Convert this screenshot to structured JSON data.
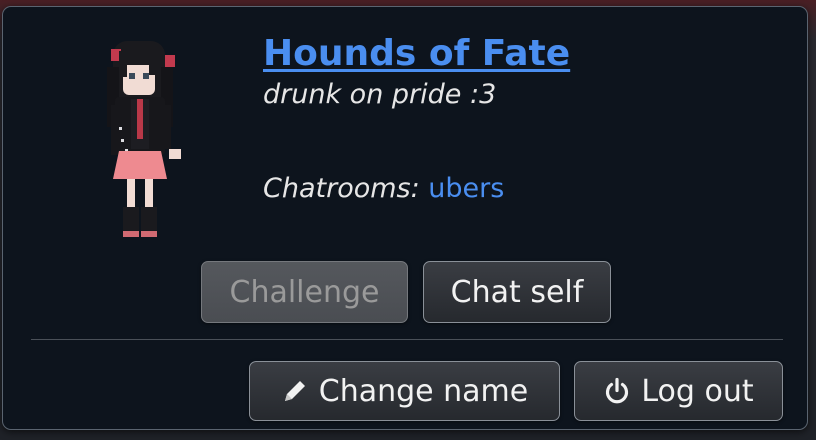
{
  "user": {
    "name": "Hounds of Fate",
    "status": "drunk on pride :3",
    "chatrooms_label": "Chatrooms:",
    "chatrooms": [
      "ubers"
    ]
  },
  "buttons": {
    "challenge": "Challenge",
    "chat_self": "Chat self",
    "change_name": "Change name",
    "log_out": "Log out"
  },
  "icons": {
    "change_name": "pencil-icon",
    "log_out": "power-icon"
  },
  "colors": {
    "link": "#4a8ef0",
    "panel_bg": "#0d141d"
  }
}
